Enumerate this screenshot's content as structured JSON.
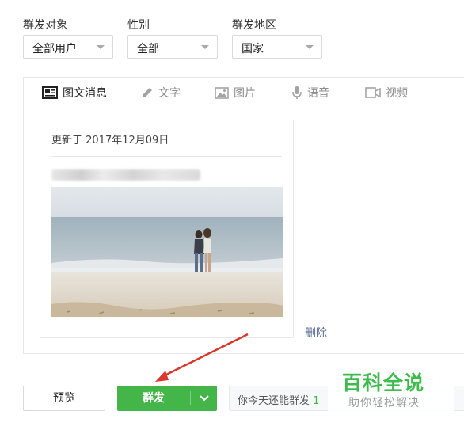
{
  "filters": [
    {
      "label": "群发对象",
      "value": "全部用户"
    },
    {
      "label": "性别",
      "value": "全部"
    },
    {
      "label": "群发地区",
      "value": "国家"
    }
  ],
  "tabs": [
    {
      "label": "图文消息",
      "icon": "article-icon",
      "active": true
    },
    {
      "label": "文字",
      "icon": "pencil-icon",
      "active": false
    },
    {
      "label": "图片",
      "icon": "image-icon",
      "active": false
    },
    {
      "label": "语音",
      "icon": "microphone-icon",
      "active": false
    },
    {
      "label": "视频",
      "icon": "video-icon",
      "active": false
    }
  ],
  "article": {
    "updated": "更新于 2017年12月09日",
    "delete_label": "删除"
  },
  "actions": {
    "preview_label": "预览",
    "send_label": "群发",
    "quota_text": "你今天还能群发",
    "quota_count": "1"
  },
  "watermark": {
    "title": "百科全说",
    "subtitle": "助你轻松解决"
  },
  "colors": {
    "accent_green": "#44b549",
    "link_blue": "#576b95",
    "annotation_red": "#d9372c"
  }
}
